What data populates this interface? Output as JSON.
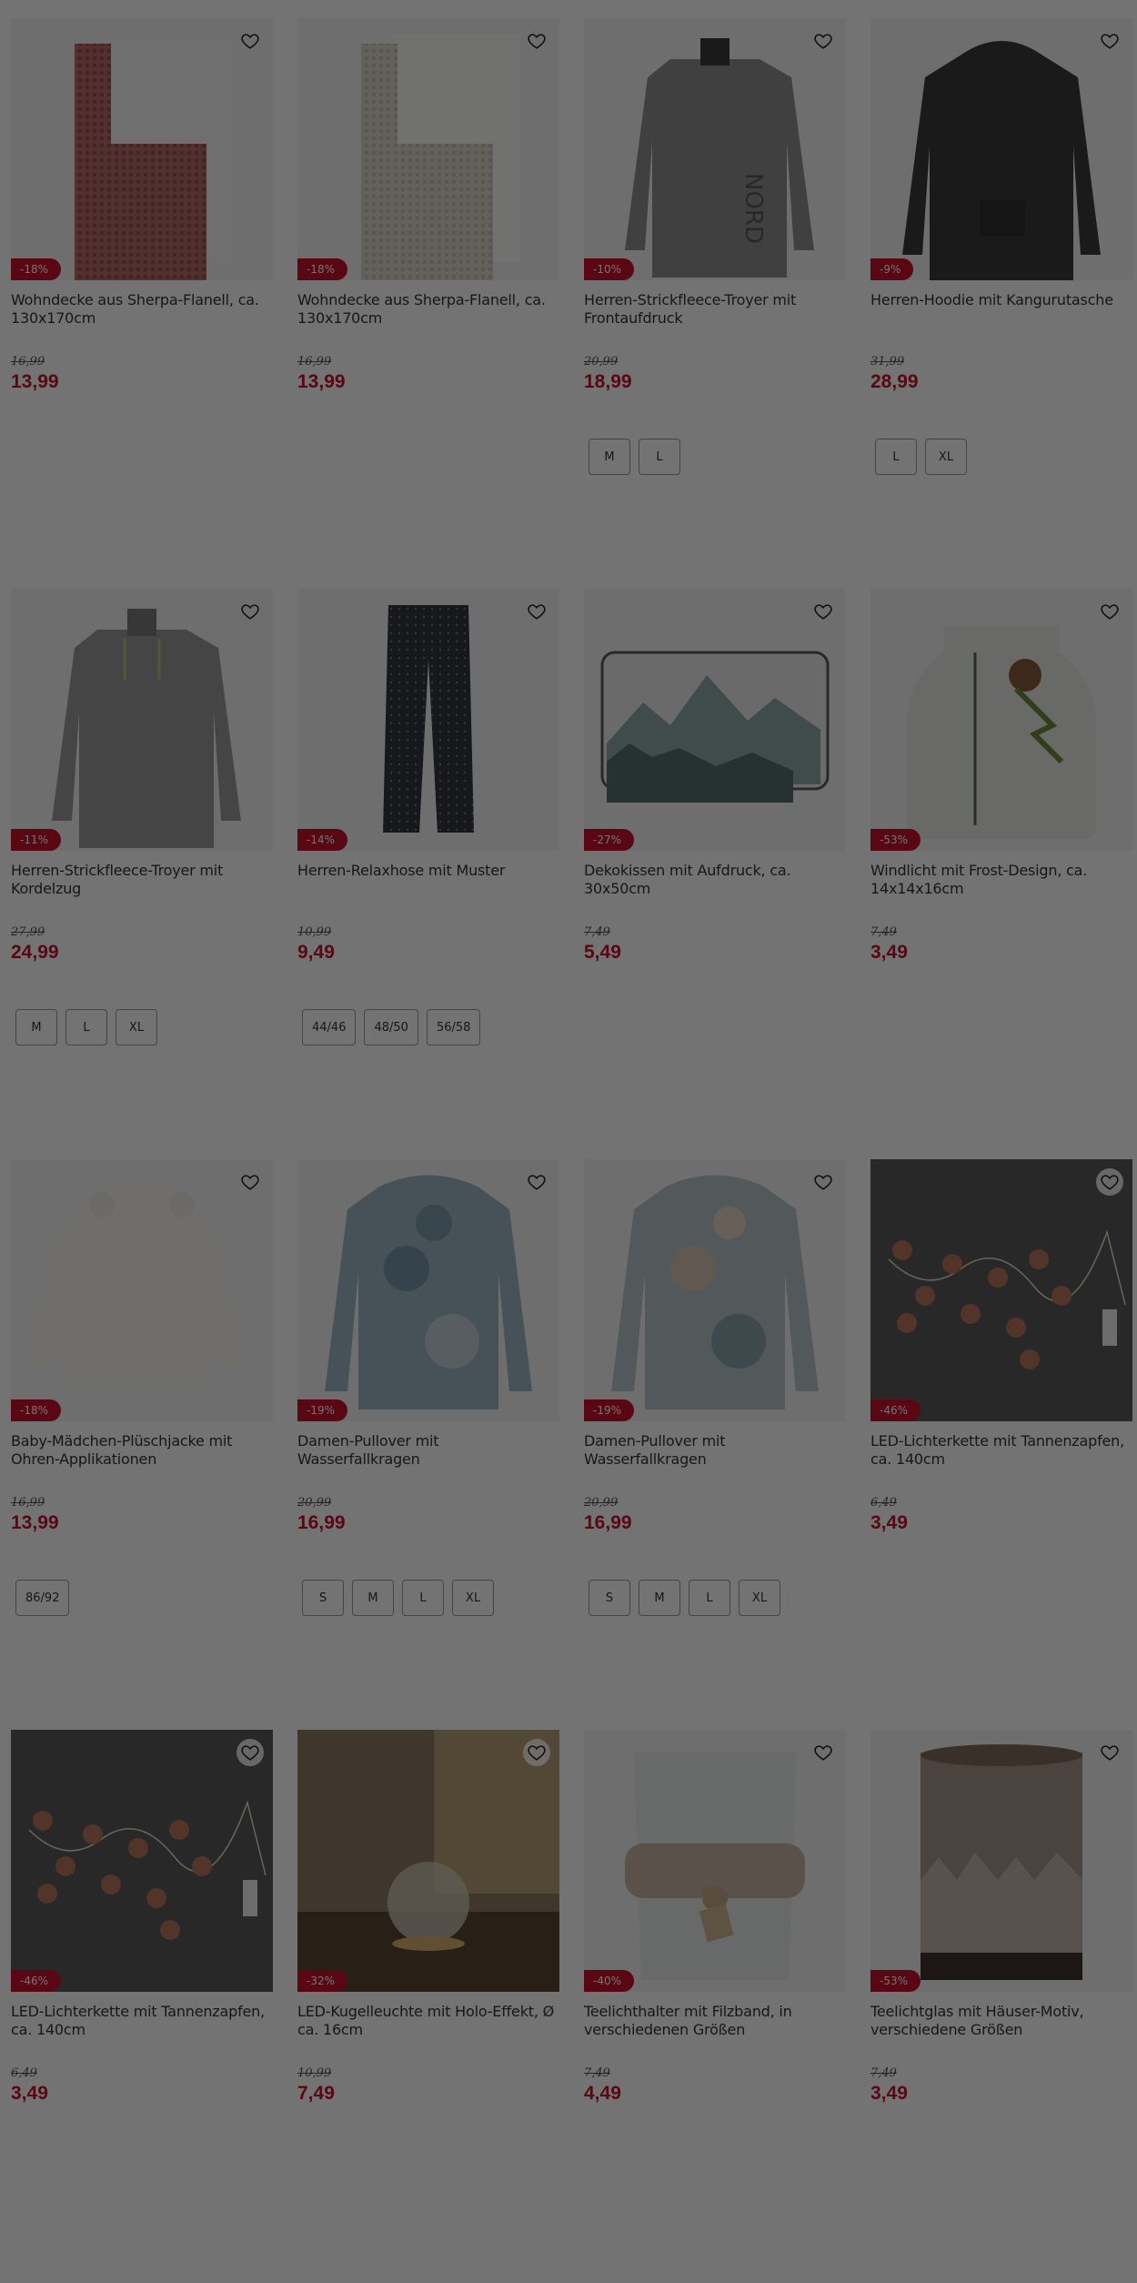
{
  "colors": {
    "accent": "#c8102e",
    "overlay": "rgba(0,0,0,0.55)"
  },
  "favorite_icon": "heart-outline-icon",
  "products": [
    {
      "title": "Wohndecke aus Sherpa-Flanell, ca. 130x170cm",
      "badge": "-18%",
      "old_price": "16,99",
      "price": "13,99",
      "sizes": [],
      "image": "blanket-red"
    },
    {
      "title": "Wohndecke aus Sherpa-Flanell, ca. 130x170cm",
      "badge": "-18%",
      "old_price": "16,99",
      "price": "13,99",
      "sizes": [],
      "image": "blanket-beige"
    },
    {
      "title": "Herren-Strickfleece-Troyer mit Frontaufdruck",
      "badge": "-10%",
      "old_price": "20,99",
      "price": "18,99",
      "sizes": [
        "M",
        "L"
      ],
      "image": "troyer-print"
    },
    {
      "title": "Herren-Hoodie mit Kangurutasche",
      "badge": "-9%",
      "old_price": "31,99",
      "price": "28,99",
      "sizes": [
        "L",
        "XL"
      ],
      "image": "hoodie"
    },
    {
      "title": "Herren-Strickfleece-Troyer mit Kordelzug",
      "badge": "-11%",
      "old_price": "27,99",
      "price": "24,99",
      "sizes": [
        "M",
        "L",
        "XL"
      ],
      "image": "troyer"
    },
    {
      "title": "Herren-Relaxhose mit Muster",
      "badge": "-14%",
      "old_price": "10,99",
      "price": "9,49",
      "sizes": [
        "44/46",
        "48/50",
        "56/58"
      ],
      "image": "pants"
    },
    {
      "title": "Dekokissen mit Aufdruck, ca. 30x50cm",
      "badge": "-27%",
      "old_price": "7,49",
      "price": "5,49",
      "sizes": [],
      "image": "pillow"
    },
    {
      "title": "Windlicht mit Frost-Design, ca. 14x14x16cm",
      "badge": "-53%",
      "old_price": "7,49",
      "price": "3,49",
      "sizes": [],
      "image": "jar"
    },
    {
      "title": "Baby-Mädchen-Plüschjacke mit Ohren-Applikationen",
      "badge": "-18%",
      "old_price": "16,99",
      "price": "13,99",
      "sizes": [
        "86/92"
      ],
      "image": "baby-jacket"
    },
    {
      "title": "Damen-Pullover mit Wasserfallkragen",
      "badge": "-19%",
      "old_price": "20,99",
      "price": "16,99",
      "sizes": [
        "S",
        "M",
        "L",
        "XL"
      ],
      "image": "pullover-blue"
    },
    {
      "title": "Damen-Pullover mit Wasserfallkragen",
      "badge": "-19%",
      "old_price": "20,99",
      "price": "16,99",
      "sizes": [
        "S",
        "M",
        "L",
        "XL"
      ],
      "image": "pullover-beige"
    },
    {
      "title": "LED-Lichterkette mit Tannenzapfen, ca. 140cm",
      "badge": "-46%",
      "old_price": "6,49",
      "price": "3,49",
      "sizes": [],
      "image": "lights-cones"
    },
    {
      "title": "LED-Lichterkette mit Tannenzapfen, ca. 140cm",
      "badge": "-46%",
      "old_price": "6,49",
      "price": "3,49",
      "sizes": [],
      "image": "lights-cones"
    },
    {
      "title": "LED-Kugelleuchte mit Holo-Effekt, Ø ca. 16cm",
      "badge": "-32%",
      "old_price": "10,99",
      "price": "7,49",
      "sizes": [],
      "image": "globe-lamp"
    },
    {
      "title": "Teelichthalter mit Filzband, in verschiedenen Größen",
      "badge": "-40%",
      "old_price": "7,49",
      "price": "4,49",
      "sizes": [],
      "image": "tealight-felt"
    },
    {
      "title": "Teelichtglas mit Häuser-Motiv, verschiedene Größen",
      "badge": "-53%",
      "old_price": "7,49",
      "price": "3,49",
      "sizes": [],
      "image": "tealight-houses"
    }
  ]
}
